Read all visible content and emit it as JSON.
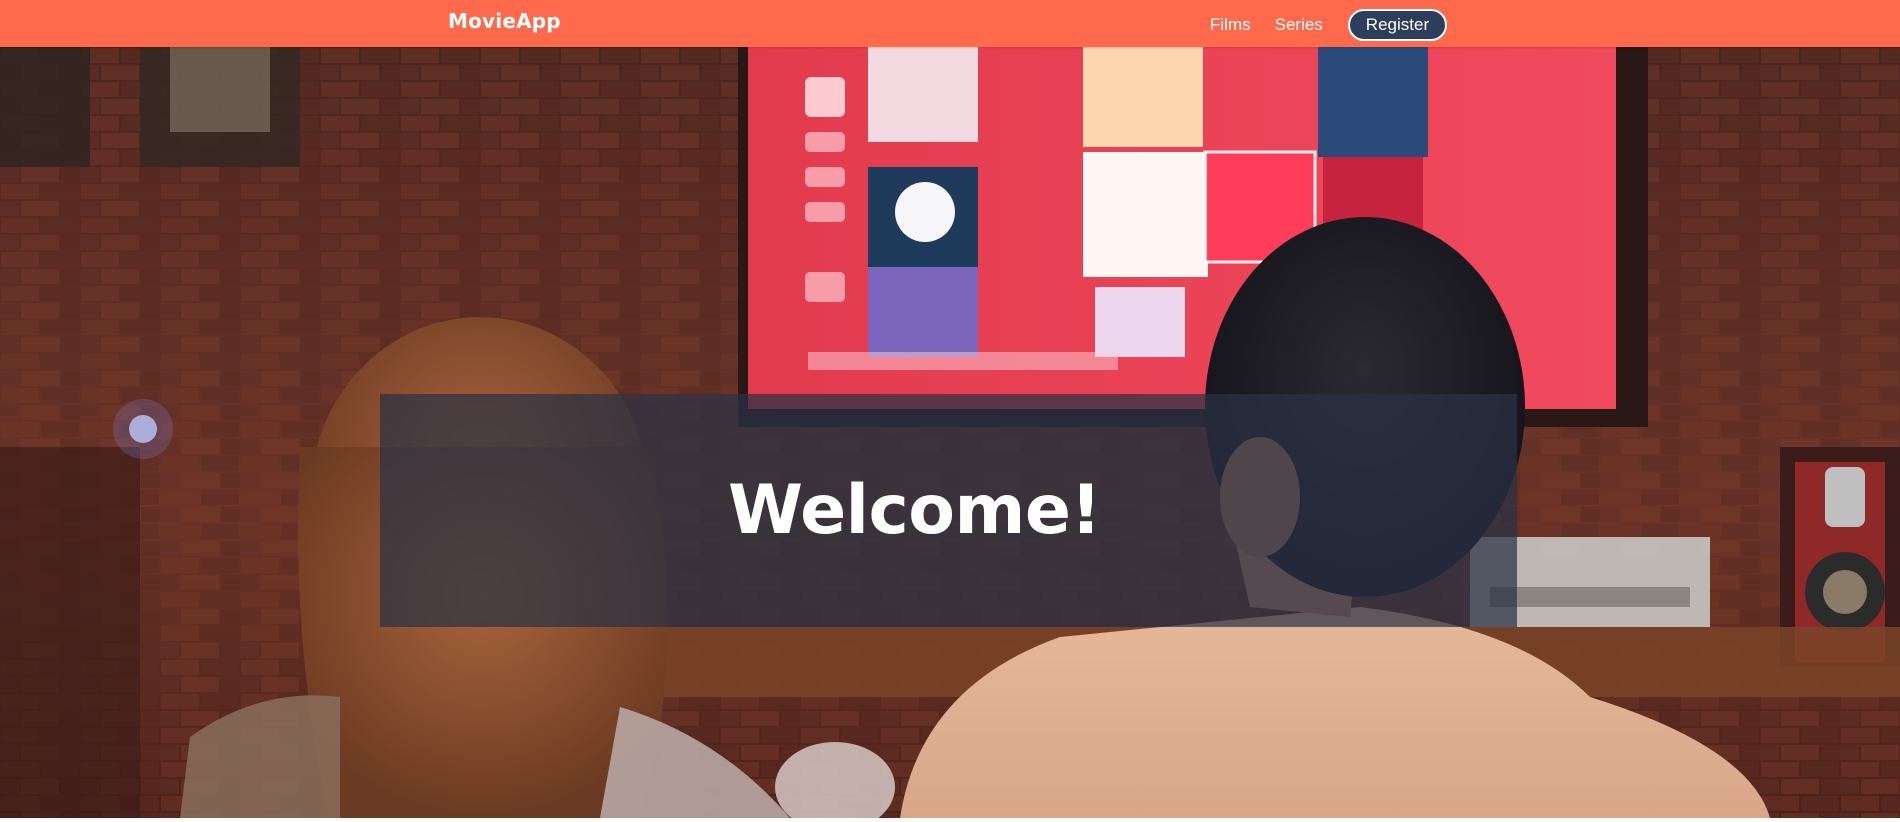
{
  "navbar": {
    "brand": "MovieApp",
    "links": [
      {
        "label": "Films"
      },
      {
        "label": "Series"
      }
    ],
    "register_label": "Register"
  },
  "hero": {
    "title": "Welcome!"
  },
  "colors": {
    "navbar": "#ff6a4d",
    "register_button": "#2d3e5c",
    "overlay": "#2a3244"
  }
}
